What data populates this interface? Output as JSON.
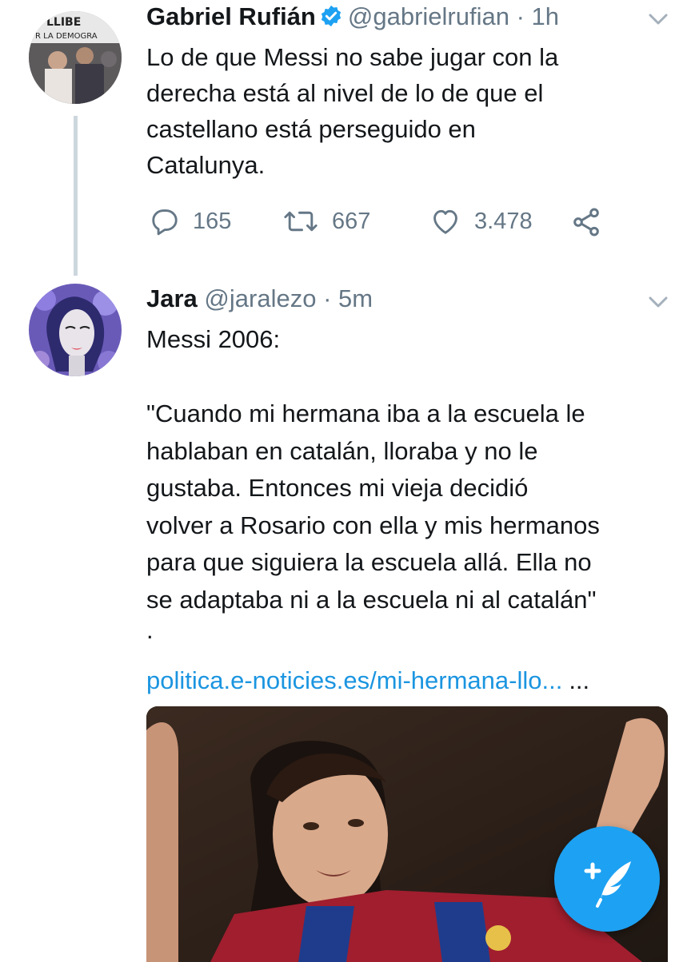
{
  "tweet1": {
    "name": "Gabriel Rufián",
    "handle": "@gabrielrufian",
    "separator": "·",
    "time": "1h",
    "avatar_text_top": "LLIBE",
    "avatar_text_banner": "R LA DEMOGRA",
    "lines": [
      "Lo de que Messi no sabe jugar con la",
      "derecha está al nivel de lo de que el",
      "castellano está perseguido en",
      "Catalunya."
    ],
    "actions": {
      "replies": "165",
      "retweets": "667",
      "likes": "3.478"
    }
  },
  "tweet2": {
    "name": "Jara",
    "handle": "@jaralezo",
    "separator": "·",
    "time": "5m",
    "lines": [
      "Messi 2006:",
      "",
      "\"Cuando mi hermana iba a la escuela le",
      "hablaban en catalán, lloraba y no le",
      "gustaba. Entonces mi vieja decidió",
      "volver a Rosario con ella y mis hermanos",
      "para que siguiera la escuela allá. Ella no",
      "se adaptaba ni a la escuela ni al catalán\"",
      "."
    ],
    "link": "politica.e-noticies.es/mi-hermana-llo...",
    "link_ellipsis": "..."
  },
  "colors": {
    "accent": "#1da1f2",
    "link": "#1b95e0",
    "secondary_text": "#657786",
    "thread_line": "#ccd6dd"
  },
  "icons": [
    "verified-badge-icon",
    "chevron-down-icon",
    "reply-icon",
    "retweet-icon",
    "like-icon",
    "share-icon",
    "compose-tweet-icon"
  ]
}
